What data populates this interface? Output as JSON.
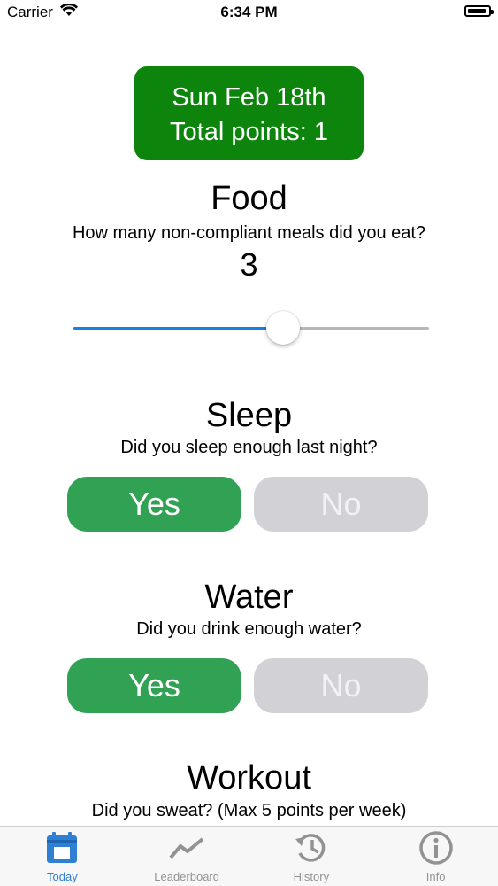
{
  "status_bar": {
    "carrier": "Carrier",
    "time": "6:34 PM",
    "wifi_icon": "wifi-icon",
    "battery_icon": "battery-icon"
  },
  "header": {
    "date": "Sun Feb 18th",
    "total_points": "Total points: 1",
    "background_color": "#0d850d"
  },
  "food": {
    "title": "Food",
    "question": "How many non-compliant meals did you eat?",
    "value": "3",
    "slider_fraction": 0.59,
    "slider_fill_color": "#1a7fe0"
  },
  "sleep": {
    "title": "Sleep",
    "question": "Did you sleep enough last night?",
    "yes_label": "Yes",
    "no_label": "No",
    "selected": "Yes"
  },
  "water": {
    "title": "Water",
    "question": "Did you drink enough water?",
    "yes_label": "Yes",
    "no_label": "No",
    "selected": "Yes"
  },
  "workout": {
    "title": "Workout",
    "question": "Did you sweat? (Max 5 points per week)"
  },
  "tabs": [
    {
      "label": "Today",
      "icon": "calendar-icon",
      "active": true
    },
    {
      "label": "Leaderboard",
      "icon": "trend-chart-icon",
      "active": false
    },
    {
      "label": "History",
      "icon": "history-clock-icon",
      "active": false
    },
    {
      "label": "Info",
      "icon": "info-icon",
      "active": false
    }
  ],
  "colors": {
    "yes_green": "#31a254",
    "no_gray": "#d1d1d6",
    "tab_active": "#2f7fd3",
    "tab_inactive": "#929292"
  }
}
